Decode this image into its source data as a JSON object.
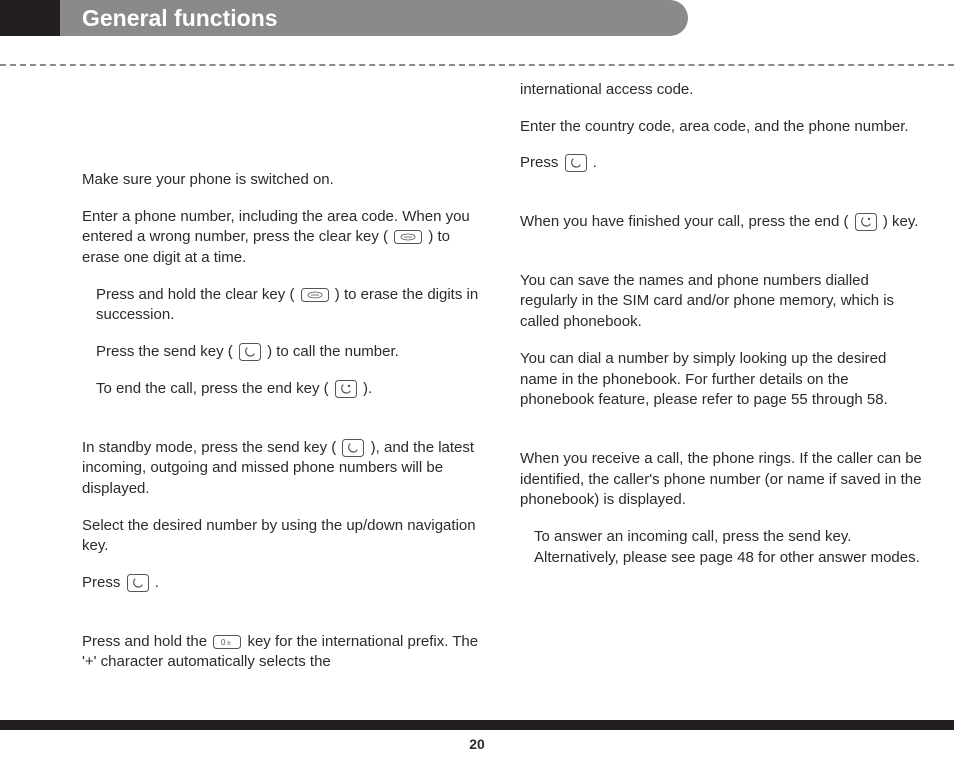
{
  "header": {
    "title": "General functions"
  },
  "page_number": "20",
  "col1": {
    "p1": "Make sure your phone is switched on.",
    "p2a": "Enter a phone number, including the area code. When you entered a wrong number, press the clear key (",
    "p2b": ") to erase one digit at a time.",
    "p3a": "Press and hold the clear key (",
    "p3b": ") to erase the digits in succession.",
    "p4a": "Press the send key (",
    "p4b": ") to call the number.",
    "p5a": "To end the call, press the end key (",
    "p5b": ").",
    "p6a": "In standby mode, press the send key (",
    "p6b": "), and the latest incoming, outgoing and missed phone numbers will be displayed.",
    "p7": "Select the desired number by using the up/down navigation key.",
    "p8a": "Press",
    "p8b": ".",
    "p9a": "Press and hold the",
    "p9b": "key for the international prefix. The '+' character automatically selects the"
  },
  "col2": {
    "p1": "international access code.",
    "p2": "Enter the country code, area code, and the phone number.",
    "p3a": "Press",
    "p3b": ".",
    "p4a": "When you have finished your call, press the end (",
    "p4b": ") key.",
    "p5": "You can save the names and phone numbers dialled regularly in the SIM card and/or phone memory, which is called phonebook.",
    "p6": "You can dial a number by simply looking up the desired name in the phonebook. For further details on the phonebook feature, please refer to page 55 through 58.",
    "p7": "When you receive a call, the phone rings. If the caller can be identified, the caller's phone number (or name if saved in the phonebook) is displayed.",
    "p8": "To answer an incoming call, press the send key. Alternatively, please see page 48 for other answer modes."
  }
}
